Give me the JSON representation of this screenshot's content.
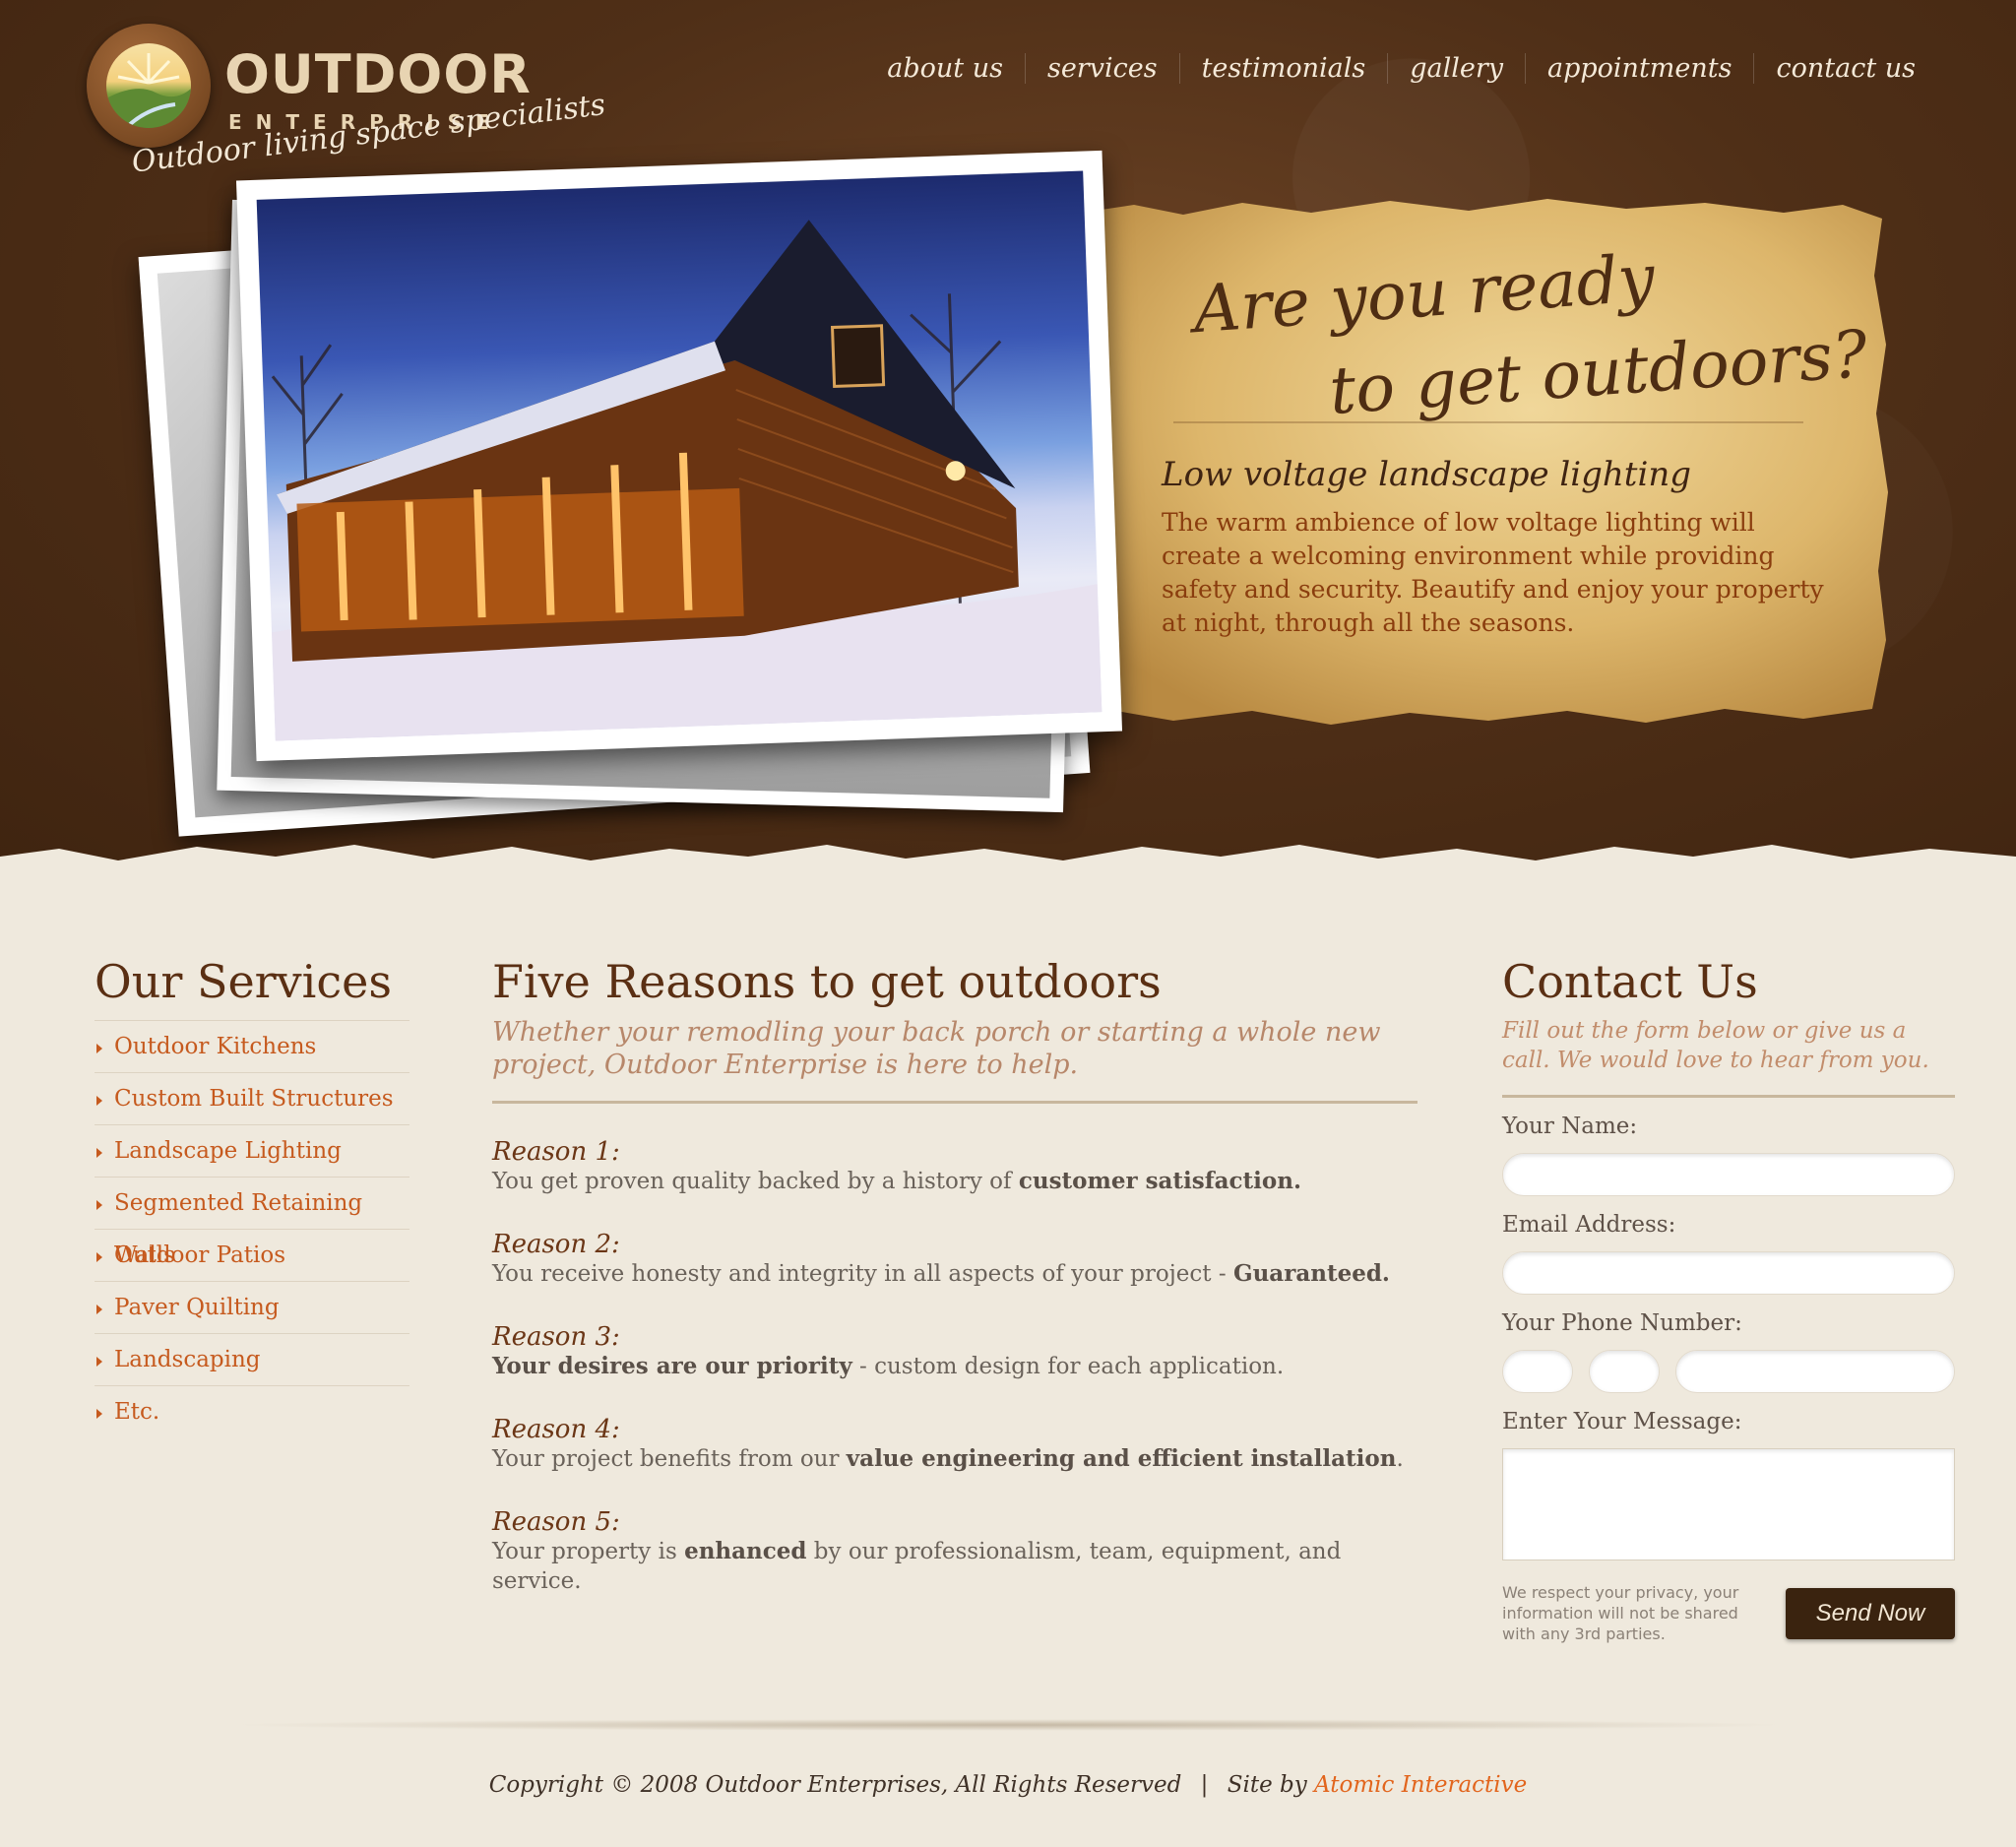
{
  "logo": {
    "name": "OUTDOOR",
    "sub": "ENTERPRISE",
    "tagline": "Outdoor living space specialists"
  },
  "nav": {
    "items": [
      "about us",
      "services",
      "testimonials",
      "gallery",
      "appointments",
      "contact us"
    ]
  },
  "hero": {
    "title_line1": "Are you ready",
    "title_line2": "to get outdoors?",
    "subtitle": "Low voltage landscape lighting",
    "body": "The warm ambience of low voltage lighting will create a welcoming environment while providing safety and security. Beautify and enjoy your property at night, through all the seasons."
  },
  "services": {
    "heading": "Our Services",
    "items": [
      "Outdoor Kitchens",
      "Custom Built Structures",
      "Landscape Lighting",
      "Segmented Retaining Walls",
      "Outdoor Patios",
      "Paver Quilting",
      "Landscaping",
      "Etc."
    ]
  },
  "reasons": {
    "heading": "Five Reasons to get outdoors",
    "subtitle": "Whether your remodling your back porch or starting a whole new project, Outdoor Enterprise is here to help.",
    "items": [
      {
        "title": "Reason 1:",
        "pre": "You get proven quality backed by a history of ",
        "bold": "customer satisfaction.",
        "post": ""
      },
      {
        "title": "Reason 2:",
        "pre": "You receive honesty and integrity in all aspects of your project - ",
        "bold": "Guaranteed.",
        "post": ""
      },
      {
        "title": "Reason 3:",
        "pre": "",
        "bold": "Your desires are our priority",
        "post": " - custom design for each application."
      },
      {
        "title": "Reason 4:",
        "pre": "Your project benefits from our ",
        "bold": "value engineering and efficient installation",
        "post": "."
      },
      {
        "title": "Reason 5:",
        "pre": "Your property is ",
        "bold": "enhanced",
        "post": " by our professionalism, team, equipment, and service."
      }
    ]
  },
  "contact": {
    "heading": "Contact Us",
    "subtitle": "Fill out the form below or give us a call. We would love to hear from you.",
    "name_label": "Your Name:",
    "email_label": "Email Address:",
    "phone_label": "Your Phone Number:",
    "message_label": "Enter Your Message:",
    "privacy": "We respect your privacy, your information will not be shared with any 3rd parties.",
    "send_label": "Send Now"
  },
  "footer": {
    "copyright": "Copyright © 2008 Outdoor Enterprises, All Rights Reserved",
    "separator": "|",
    "site_by": "Site by",
    "credit": "Atomic Interactive"
  }
}
